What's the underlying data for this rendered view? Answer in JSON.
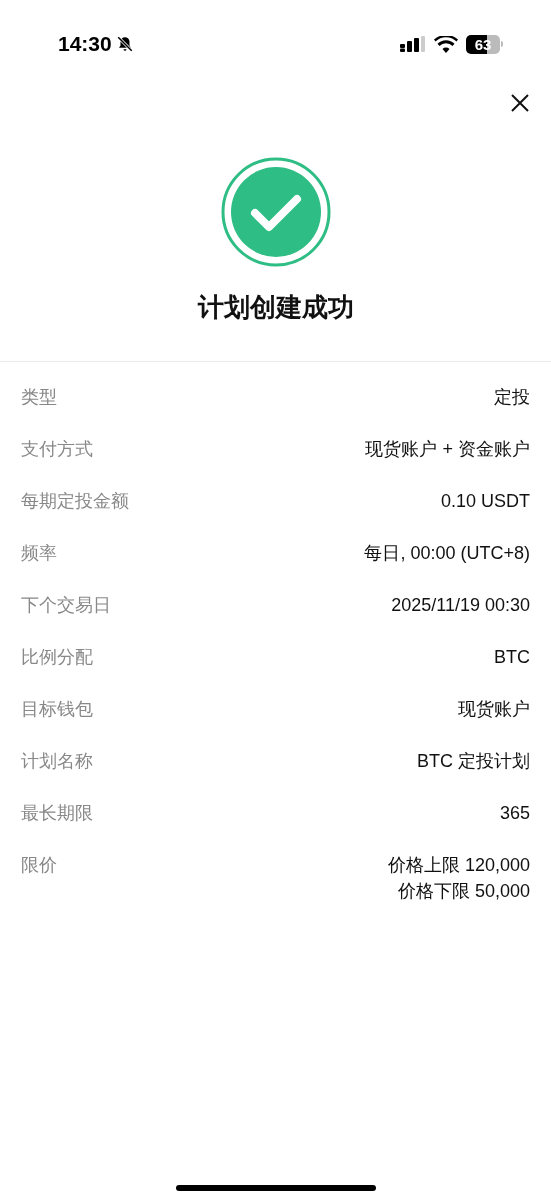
{
  "status_bar": {
    "time": "14:30",
    "battery": "63"
  },
  "title": "计划创建成功",
  "rows": [
    {
      "label": "类型",
      "values": [
        "定投"
      ]
    },
    {
      "label": "支付方式",
      "values": [
        "现货账户 + 资金账户"
      ]
    },
    {
      "label": "每期定投金额",
      "values": [
        "0.10 USDT"
      ]
    },
    {
      "label": "频率",
      "values": [
        "每日, 00:00 (UTC+8)"
      ]
    },
    {
      "label": "下个交易日",
      "values": [
        "2025/11/19 00:30"
      ]
    },
    {
      "label": "比例分配",
      "values": [
        "BTC"
      ]
    },
    {
      "label": "目标钱包",
      "values": [
        "现货账户"
      ]
    },
    {
      "label": "计划名称",
      "values": [
        "BTC 定投计划"
      ]
    },
    {
      "label": "最长期限",
      "values": [
        "365"
      ]
    },
    {
      "label": "限价",
      "values": [
        "价格上限 120,000",
        "价格下限 50,000"
      ]
    }
  ]
}
